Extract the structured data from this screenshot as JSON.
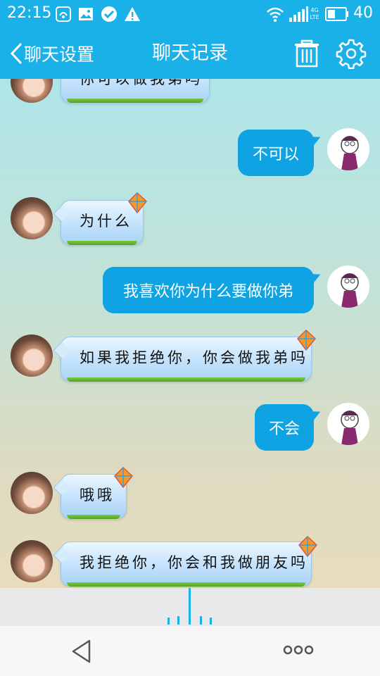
{
  "status_bar": {
    "time": "22:15",
    "network_label": "4G LTE",
    "battery": "40",
    "icons": [
      "app-notification-icon",
      "gallery-icon",
      "check-circle-icon",
      "warning-icon",
      "wifi-icon",
      "signal-icon",
      "battery-icon"
    ]
  },
  "title_bar": {
    "back_label": "聊天设置",
    "title": "聊天记录",
    "delete_icon": "trash-icon",
    "settings_icon": "gear-icon",
    "accent_color": "#1ab0e8"
  },
  "messages": [
    {
      "side": "left",
      "text": "你可以做我弟吗",
      "partial": true
    },
    {
      "side": "right",
      "text": "不可以"
    },
    {
      "side": "left",
      "text": "为什么"
    },
    {
      "side": "right",
      "text": "我喜欢你为什么要做你弟"
    },
    {
      "side": "left",
      "text": "如果我拒绝你，你会做我弟吗"
    },
    {
      "side": "right",
      "text": "不会"
    },
    {
      "side": "left",
      "text": "哦哦"
    },
    {
      "side": "left",
      "text": "我拒绝你，你会和我做朋友吗"
    }
  ],
  "voice_input": {
    "icon": "voice-waveform-icon"
  },
  "nav_bar": {
    "back_icon": "nav-back-icon",
    "menu_icon": "more-dots-icon"
  }
}
